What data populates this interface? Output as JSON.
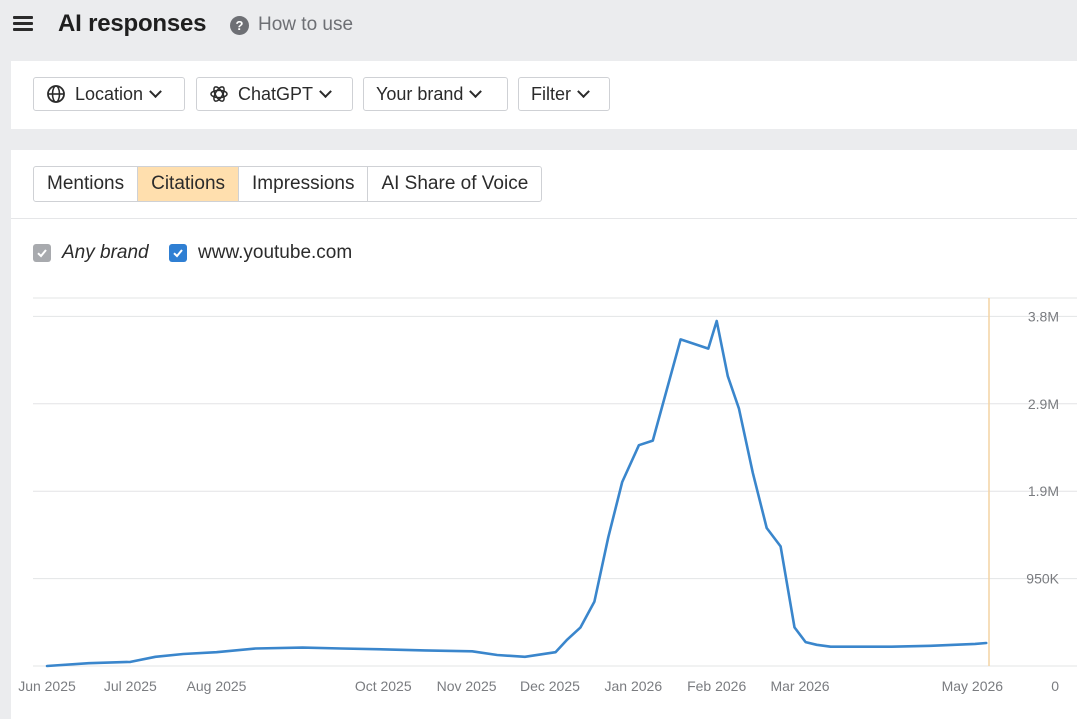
{
  "header": {
    "title": "AI responses",
    "help_label": "How to use"
  },
  "filters": {
    "location": "Location",
    "model": "ChatGPT",
    "brand": "Your brand",
    "filter": "Filter"
  },
  "tabs": [
    {
      "label": "Mentions",
      "active": false
    },
    {
      "label": "Citations",
      "active": true
    },
    {
      "label": "Impressions",
      "active": false
    },
    {
      "label": "AI Share of Voice",
      "active": false
    }
  ],
  "legend": [
    {
      "label": "Any brand",
      "checked": true,
      "color": "#a8aaae"
    },
    {
      "label": "www.youtube.com",
      "checked": true,
      "color": "#2f7fd3"
    }
  ],
  "chart_data": {
    "type": "line",
    "x_tick_labels": [
      "Jun 2025",
      "Jul 2025",
      "Aug 2025",
      "Oct 2025",
      "Nov 2025",
      "Dec 2025",
      "Jan 2026",
      "Feb 2026",
      "Mar 2026",
      "May 2026"
    ],
    "y_tick_labels": [
      "0",
      "950K",
      "1.9M",
      "2.9M",
      "3.8M"
    ],
    "y_ticks": [
      0,
      950000,
      1900000,
      2850000,
      3800000
    ],
    "ylim": [
      0,
      3800000
    ],
    "y_axis_side": "right",
    "grid": true,
    "series": [
      {
        "name": "www.youtube.com",
        "color": "#3a86cc",
        "x": [
          "2025-06-01",
          "2025-06-16",
          "2025-07-01",
          "2025-07-10",
          "2025-07-20",
          "2025-08-01",
          "2025-08-15",
          "2025-09-01",
          "2025-09-15",
          "2025-10-01",
          "2025-10-15",
          "2025-11-01",
          "2025-11-10",
          "2025-11-20",
          "2025-12-01",
          "2025-12-05",
          "2025-12-10",
          "2025-12-15",
          "2025-12-20",
          "2025-12-25",
          "2025-12-31",
          "2026-01-05",
          "2026-01-10",
          "2026-01-15",
          "2026-01-20",
          "2026-01-25",
          "2026-01-28",
          "2026-02-01",
          "2026-02-05",
          "2026-02-10",
          "2026-02-15",
          "2026-02-20",
          "2026-02-25",
          "2026-03-01",
          "2026-03-05",
          "2026-03-10",
          "2026-03-15",
          "2026-03-20",
          "2026-04-01",
          "2026-04-15",
          "2026-05-01",
          "2026-05-05"
        ],
        "values": [
          0,
          30000,
          45000,
          100000,
          130000,
          150000,
          190000,
          200000,
          190000,
          180000,
          170000,
          160000,
          120000,
          100000,
          150000,
          280000,
          420000,
          700000,
          1400000,
          2000000,
          2400000,
          2450000,
          3000000,
          3550000,
          3500000,
          3450000,
          3750000,
          3150000,
          2800000,
          2100000,
          1500000,
          1300000,
          420000,
          260000,
          230000,
          210000,
          210000,
          210000,
          210000,
          220000,
          240000,
          250000
        ]
      }
    ]
  }
}
